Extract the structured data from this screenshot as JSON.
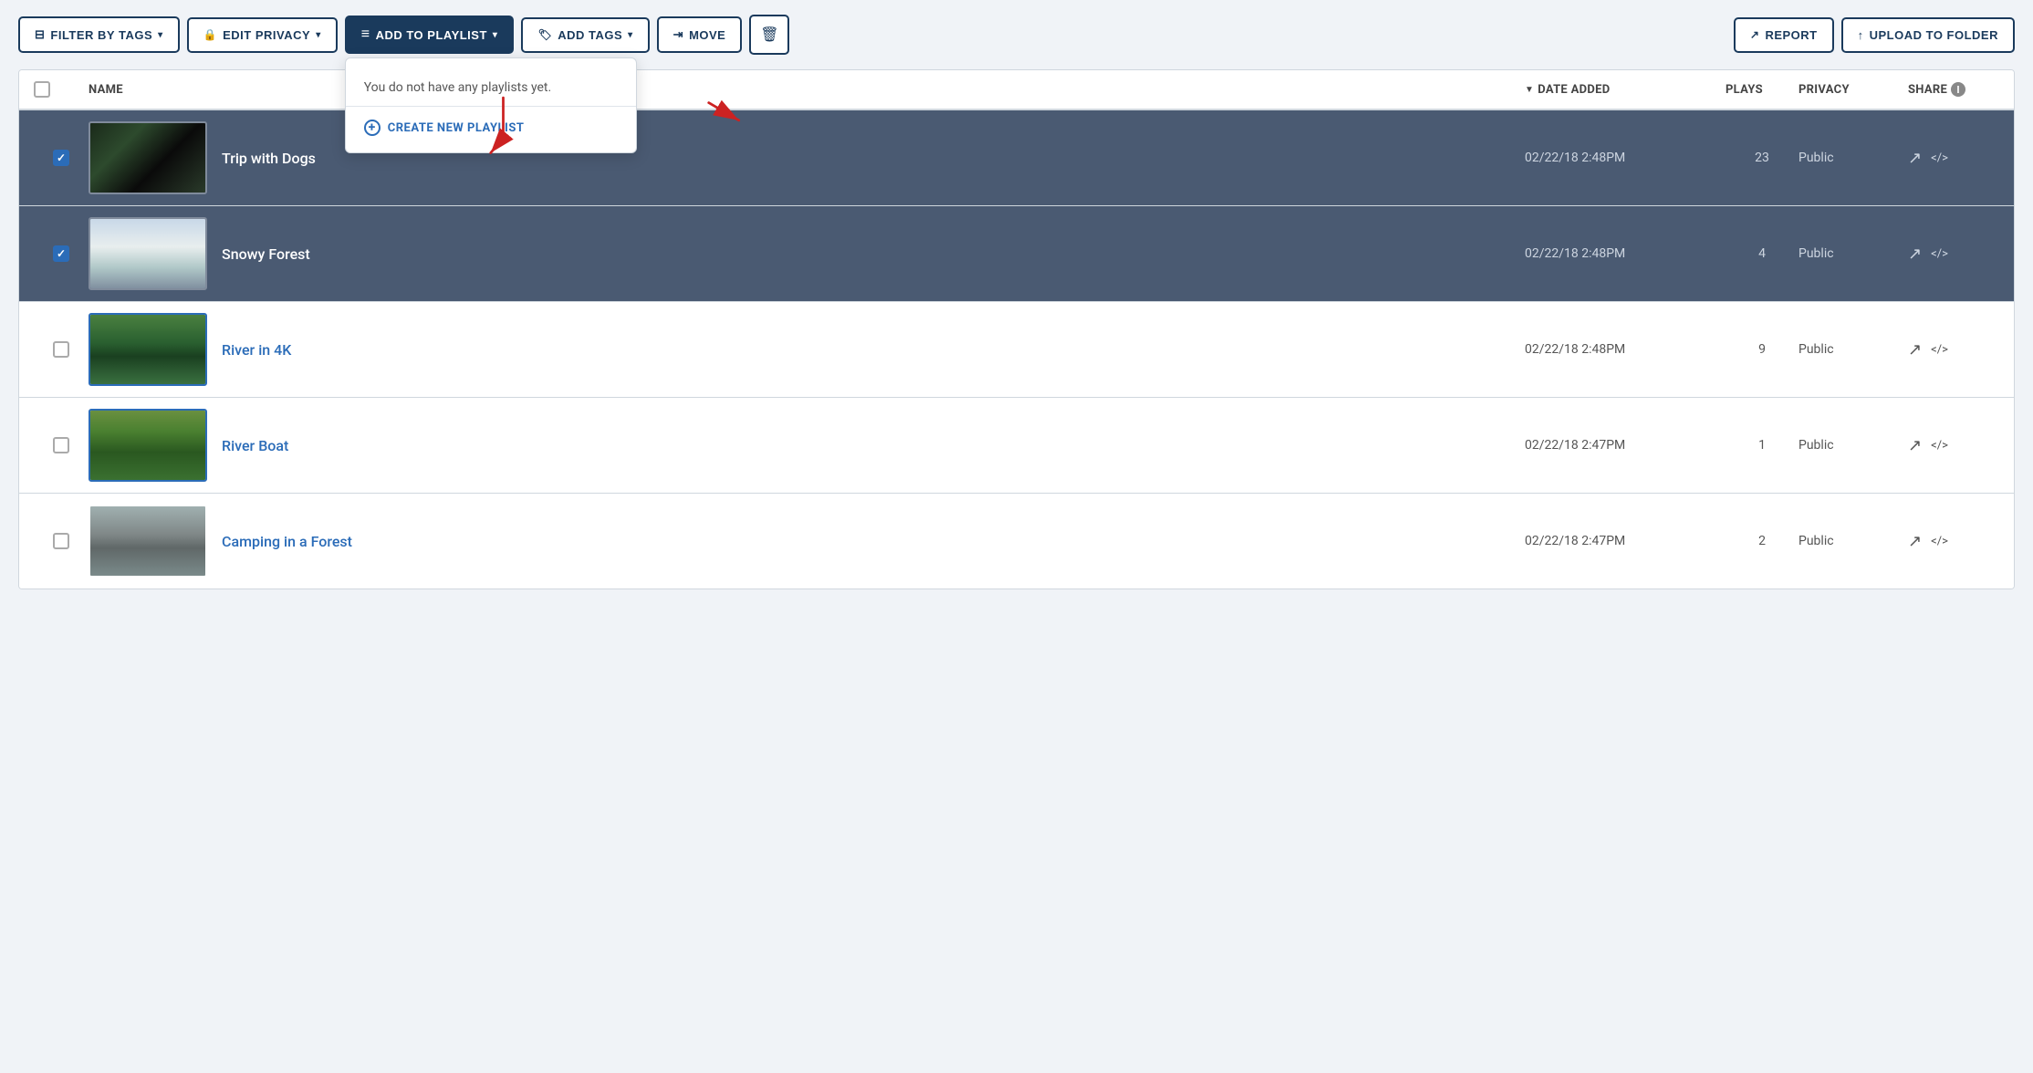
{
  "toolbar": {
    "filter_btn": "FILTER BY TAGS",
    "edit_privacy_btn": "EDIT PRIVACY",
    "add_playlist_btn": "ADD TO PLAYLIST",
    "add_tags_btn": "ADD TAGS",
    "move_btn": "MOVE",
    "report_btn": "REPORT",
    "upload_btn": "UPLOAD TO FOLDER"
  },
  "dropdown": {
    "empty_text": "You do not have any playlists yet.",
    "create_label": "CREATE NEW PLAYLIST"
  },
  "table": {
    "headers": {
      "name": "NAME",
      "date_added": "DATE ADDED",
      "plays": "PLAYS",
      "privacy": "PRIVACY",
      "share": "SHARE"
    },
    "rows": [
      {
        "id": 1,
        "selected": true,
        "name": "Trip with Dogs",
        "date": "02/22/18 2:48PM",
        "plays": "23",
        "privacy": "Public",
        "thumb": "forest"
      },
      {
        "id": 2,
        "selected": true,
        "name": "Snowy Forest",
        "date": "02/22/18 2:48PM",
        "plays": "4",
        "privacy": "Public",
        "thumb": "snowy"
      },
      {
        "id": 3,
        "selected": false,
        "name": "River in 4K",
        "date": "02/22/18 2:48PM",
        "plays": "9",
        "privacy": "Public",
        "thumb": "river4k"
      },
      {
        "id": 4,
        "selected": false,
        "name": "River Boat",
        "date": "02/22/18 2:47PM",
        "plays": "1",
        "privacy": "Public",
        "thumb": "riverboat"
      },
      {
        "id": 5,
        "selected": false,
        "name": "Camping in a Forest",
        "date": "02/22/18 2:47PM",
        "plays": "2",
        "privacy": "Public",
        "thumb": "camping"
      }
    ]
  }
}
